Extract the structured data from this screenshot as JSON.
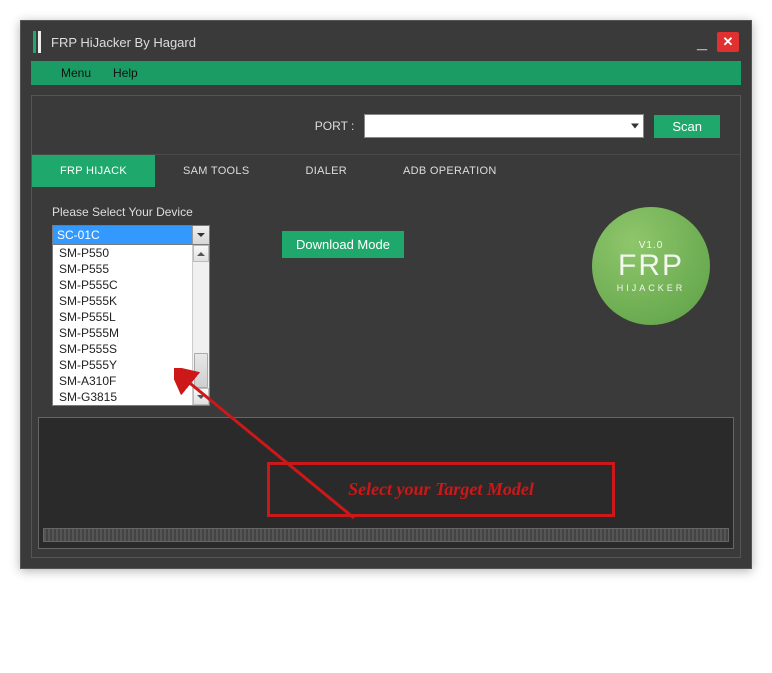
{
  "title": "FRP HiJacker By Hagard",
  "menu": {
    "items": [
      "Menu",
      "Help"
    ]
  },
  "port": {
    "label": "PORT :",
    "value": "",
    "scan_label": "Scan"
  },
  "tabs": [
    "FRP HIJACK",
    "SAM TOOLS",
    "DIALER",
    "ADB OPERATION"
  ],
  "active_tab": 0,
  "device": {
    "label": "Please Select Your Device",
    "selected": "SC-01C",
    "options": [
      "SM-P550",
      "SM-P555",
      "SM-P555C",
      "SM-P555K",
      "SM-P555L",
      "SM-P555M",
      "SM-P555S",
      "SM-P555Y",
      "SM-A310F",
      "SM-G3815"
    ]
  },
  "download_mode_label": "Download Mode",
  "logo": {
    "version": "V1.0",
    "main": "FRP",
    "sub": "HIJACKER"
  },
  "annotation": "Select your Target Model"
}
